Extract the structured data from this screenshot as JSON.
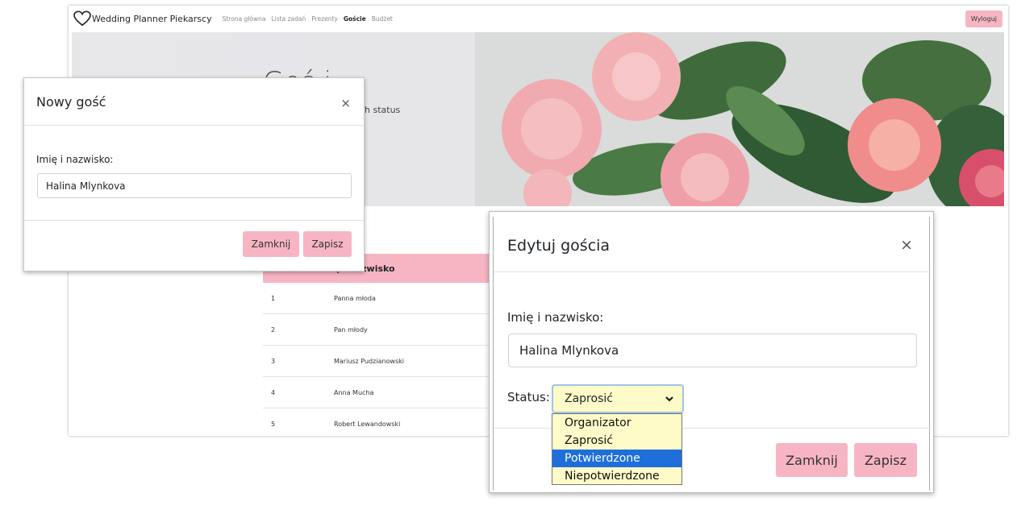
{
  "navbar": {
    "brand": "Wedding Planner Piekarscy",
    "links": [
      "Strona główna",
      "Lista zadań",
      "Prezenty",
      "Goście",
      "Budżet"
    ],
    "active_link": "Goście",
    "logout": "Wyloguj"
  },
  "hero": {
    "title_visible": "Goś i",
    "subtitle_visible": "h status"
  },
  "guests_table": {
    "header_visible": "ę i nazwisko",
    "rows": [
      {
        "no": "1",
        "name": "Panna młoda"
      },
      {
        "no": "2",
        "name": "Pan młody"
      },
      {
        "no": "3",
        "name": "Mariusz Pudzianowski"
      },
      {
        "no": "4",
        "name": "Anna Mucha"
      },
      {
        "no": "5",
        "name": "Robert Lewandowski"
      }
    ]
  },
  "new_guest_modal": {
    "title": "Nowy gość",
    "close_symbol": "×",
    "name_label": "Imię i nazwisko:",
    "name_value": "Halina Mlynkova",
    "close_button": "Zamknij",
    "save_button": "Zapisz"
  },
  "edit_guest_modal": {
    "title": "Edytuj gościa",
    "close_symbol": "×",
    "name_label": "Imię i nazwisko:",
    "name_value": "Halina Mlynkova",
    "status_label": "Status:",
    "status_selected": "Zaprosić",
    "status_options": [
      "Organizator",
      "Zaprosić",
      "Potwierdzone",
      "Niepotwierdzone"
    ],
    "status_highlighted": "Potwierdzone",
    "close_button": "Zamknij",
    "save_button": "Zapisz"
  },
  "colors": {
    "accent_pink": "#f7b5c3",
    "select_bg": "#fffbc9",
    "option_highlight": "#1e6fd9"
  },
  "icons": {
    "brand": "heart-outline-icon",
    "select": "chevron-down-icon",
    "close": "close-icon"
  }
}
